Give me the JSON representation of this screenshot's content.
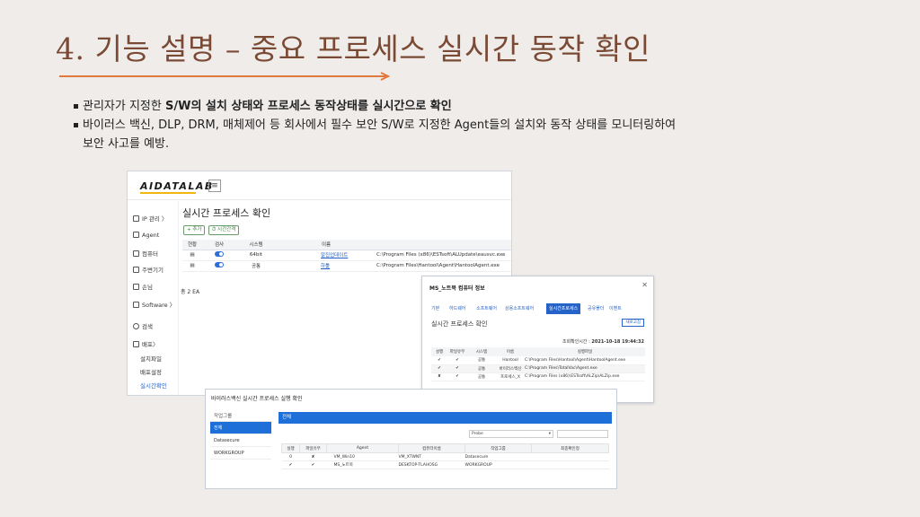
{
  "slide": {
    "title": "4. 기능 설명 – 중요 프로세스 실시간 동작 확인",
    "bullet1_pre": "관리자가 지정한 ",
    "bullet1_bold": "S/W의 설치 상태와 프로세스 동작상태를 실시간으로 확인",
    "bullet2_line1": "바이러스 백신, DLP, DRM, 매체제어 등 회사에서 필수 보안 S/W로 지정한 Agent들의 설치와 동작 상태를 모니터링하여",
    "bullet2_line2": "보안 사고를 예방."
  },
  "main_window": {
    "logo": "AIDATALAB",
    "menu_icon": "≡",
    "sidebar": [
      {
        "label": "IP 관리 〉",
        "icon": "network-icon"
      },
      {
        "label": "Agent",
        "icon": "agent-icon"
      },
      {
        "label": "컴퓨터",
        "icon": "computer-icon"
      },
      {
        "label": "주변기기",
        "icon": "printer-icon"
      },
      {
        "label": "손님",
        "icon": "guest-icon"
      },
      {
        "label": "Software 〉",
        "icon": "software-icon"
      },
      {
        "label": "검색",
        "icon": "search-icon"
      },
      {
        "label": "배포〉",
        "icon": "deploy-icon"
      }
    ],
    "sub_items": [
      "설치파일",
      "배포설정",
      "실시간확인"
    ],
    "page_title": "실시간 프로세스 확인",
    "add_button": "+ 추가",
    "interval_button": "⏱ 시간간격",
    "columns": [
      "현황",
      "검사",
      "시스템",
      "이름"
    ],
    "rows": [
      {
        "system": "64bit",
        "name": "알집업데이트",
        "path": "C:\\Program Files (x86)\\ESTsoft\\ALUpdate\\eausvc.exe"
      },
      {
        "system": "공통",
        "name": "하툴",
        "path": "C:\\Program Files\\Hantool\\Agent\\HantoolAgent.exe"
      }
    ],
    "total": "총 2 EA"
  },
  "popup": {
    "title": "MS_노트북 컴퓨터 정보",
    "tabs": [
      "기본",
      "하드웨어",
      "소프트웨어",
      "상용소프트웨어",
      "실시간프로세스",
      "공유폴더",
      "이벤트"
    ],
    "active_tab": "실시간프로세스",
    "subtitle": "실시간 프로세스 확인",
    "refresh": "새로고침",
    "time_label": "조회확인시간",
    "time_value": "2021-10-18 19:44:32",
    "columns": [
      "설행",
      "파일유무",
      "시스템",
      "이름",
      "실행파일"
    ],
    "rows": [
      {
        "run": "✔",
        "file": "✔",
        "system": "공통",
        "name": "Hantool",
        "exe": "C:\\Program Files\\Hantool\\Agent\\HantoolAgent.exe"
      },
      {
        "run": "✔",
        "file": "✔",
        "system": "공통",
        "name": "바이러스백신",
        "exe": "C:\\Program Files\\TotalVac\\Agent.exe"
      },
      {
        "run": "✘",
        "file": "✔",
        "system": "공통",
        "name": "프로세스_X",
        "exe": "C:\\Program Files (x86)\\ESTsoft\\ALZip\\ALZip.exe"
      }
    ]
  },
  "status_window": {
    "title": "바이러스백신 실시간 프로세스 실행 확인",
    "group_header": "작업그룹",
    "groups": [
      "전체",
      "Datasecure",
      "WORKGROUP"
    ],
    "bar_label": "전체",
    "select_value": "Probe",
    "columns": [
      "실행",
      "파일유무",
      "Agent",
      "컴퓨터이름",
      "작업그룹",
      "최종확인정"
    ],
    "rows": [
      {
        "run": "0",
        "file": "✘",
        "agent": "VM_Win10",
        "computer": "VM_XTWNT",
        "group": "Datasecure",
        "last": ""
      },
      {
        "run": "✔",
        "file": "✔",
        "agent": "MS_노트북",
        "computer": "DESKTOP-TLAHOSG",
        "group": "WORKGROUP",
        "last": ""
      }
    ]
  },
  "colors": {
    "title": "#7a4a35",
    "arrow": "#e07a3c",
    "accent": "#2563c9"
  }
}
